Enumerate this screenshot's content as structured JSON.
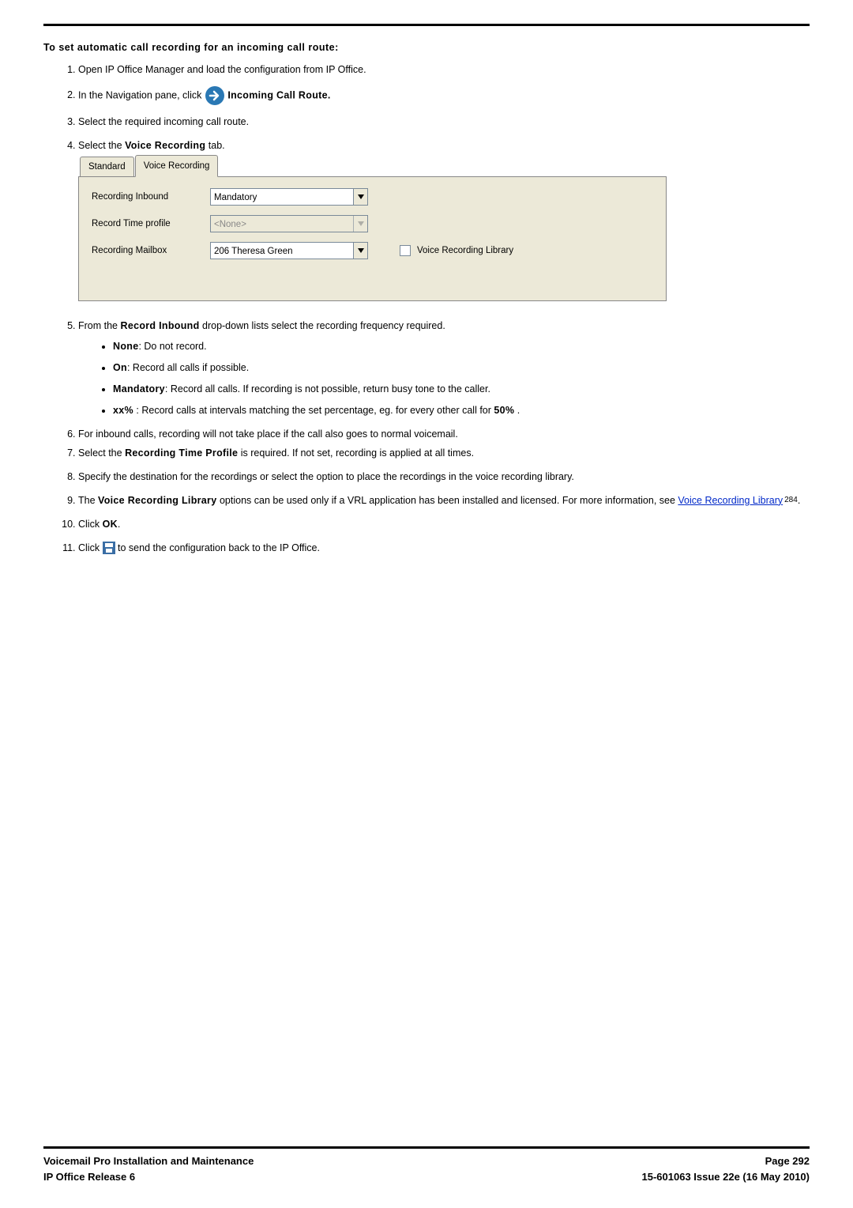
{
  "heading": "To set automatic call recording for an incoming call route:",
  "steps": {
    "s1": "Open IP Office Manager and load the configuration from IP Office.",
    "s2_a": "In the Navigation pane, click ",
    "s2_b": " Incoming Call Route.",
    "s3": "Select the required incoming call route.",
    "s4_a": "Select the ",
    "s4_b": "Voice Recording",
    "s4_c": " tab.",
    "s5_a": "From the ",
    "s5_b": "Record Inbound",
    "s5_c": " drop-down lists select the recording frequency required.",
    "s5_bullets": {
      "b1a": "None",
      "b1b": ": Do not record.",
      "b2a": "On",
      "b2b": ": Record all calls if possible.",
      "b3a": "Mandatory",
      "b3b": ": Record all calls. If recording is not possible, return busy tone to the caller.",
      "b4a": "xx%",
      "b4b": " : Record calls at intervals matching the set percentage, eg. for every other call for ",
      "b4c": "50%",
      "b4d": " ."
    },
    "s6": "For inbound calls, recording will not take place if the call also goes to normal voicemail.",
    "s7_a": "Select the ",
    "s7_b": "Recording Time Profile",
    "s7_c": " is required. If not set, recording is applied at all times.",
    "s8": "Specify the destination for the recordings or select the option to place the recordings in the voice recording library.",
    "s9_a": "The ",
    "s9_b": "Voice Recording Library",
    "s9_c": " options can be used only if a VRL application has been installed and licensed. For more information, see ",
    "s9_link": "Voice Recording Library",
    "s9_ref": "284",
    "s9_d": ".",
    "s10_a": "Click ",
    "s10_b": "OK",
    "s10_c": ".",
    "s11_a": "Click ",
    "s11_b": " to send the configuration back to the IP Office."
  },
  "screenshot": {
    "tabs": {
      "standard": "Standard",
      "voice_recording": "Voice Recording"
    },
    "rows": {
      "r1_label": "Recording Inbound",
      "r1_value": "Mandatory",
      "r2_label": "Record Time profile",
      "r2_value": "<None>",
      "r3_label": "Recording Mailbox",
      "r3_value": "206 Theresa Green",
      "chk_label": "Voice Recording Library"
    }
  },
  "footer": {
    "left1": "Voicemail Pro Installation and Maintenance",
    "left2": "IP Office Release 6",
    "right1": "Page 292",
    "right2": "15-601063 Issue 22e (16 May 2010)"
  }
}
